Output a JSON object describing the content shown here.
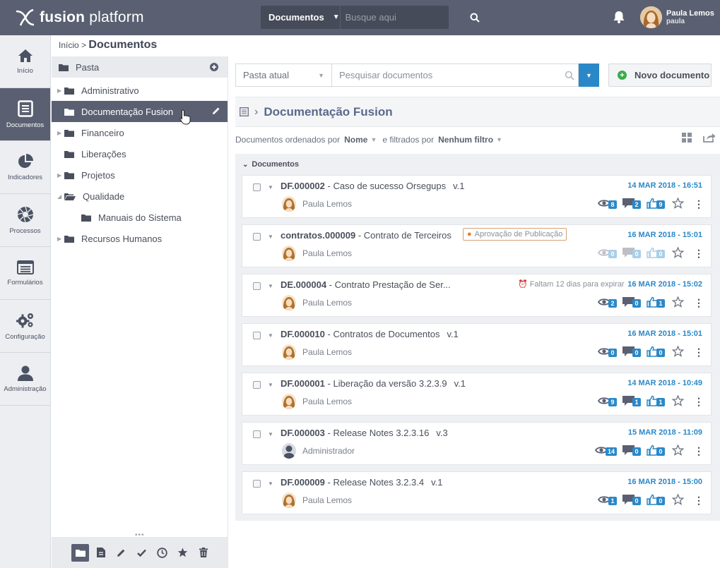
{
  "brand": {
    "name_bold": "fusion",
    "name_rest": " platform"
  },
  "search": {
    "scope": "Documentos",
    "placeholder": "Busque aqui"
  },
  "user": {
    "name": "Paula Lemos",
    "login": "paula"
  },
  "rail": [
    {
      "label": "Início",
      "icon": "home-icon",
      "active": false
    },
    {
      "label": "Documentos",
      "icon": "document-icon",
      "active": true
    },
    {
      "label": "Indicadores",
      "icon": "pie-chart-icon",
      "active": false
    },
    {
      "label": "Processos",
      "icon": "aperture-icon",
      "active": false
    },
    {
      "label": "Formulários",
      "icon": "form-icon",
      "active": false
    },
    {
      "label": "Configuração",
      "icon": "gears-icon",
      "active": false
    },
    {
      "label": "Administração",
      "icon": "user-icon",
      "active": false
    }
  ],
  "breadcrumb": {
    "home": "Início",
    "sep": ">",
    "current": "Documentos"
  },
  "folders": {
    "header": "Pasta",
    "items": [
      {
        "label": "Administrativo",
        "level": 0,
        "expandable": true,
        "open": false,
        "active": false
      },
      {
        "label": "Documentação Fusion",
        "level": 0,
        "expandable": false,
        "open": false,
        "active": true
      },
      {
        "label": "Financeiro",
        "level": 0,
        "expandable": true,
        "open": false,
        "active": false
      },
      {
        "label": "Liberações",
        "level": 0,
        "expandable": false,
        "open": false,
        "active": false
      },
      {
        "label": "Projetos",
        "level": 0,
        "expandable": true,
        "open": false,
        "active": false
      },
      {
        "label": "Qualidade",
        "level": 0,
        "expandable": true,
        "open": true,
        "active": false
      },
      {
        "label": "Manuais do Sistema",
        "level": 1,
        "expandable": false,
        "open": false,
        "active": false
      },
      {
        "label": "Recursos Humanos",
        "level": 0,
        "expandable": true,
        "open": false,
        "active": false
      }
    ],
    "footer_icons": [
      "folder-icon",
      "file-icon",
      "pencil-icon",
      "check-icon",
      "clock-icon",
      "star-icon",
      "trash-icon"
    ]
  },
  "toolbar": {
    "scope": "Pasta atual",
    "search_placeholder": "Pesquisar documentos",
    "new_doc": "Novo documento"
  },
  "folder_title": "Documentação Fusion",
  "sort": {
    "prefix": "Documentos ordenados por",
    "order": "Nome",
    "filter_prefix": "e filtrados por",
    "filter": "Nenhum filtro"
  },
  "list": {
    "group": "Documentos",
    "docs": [
      {
        "code": "DF.000002",
        "title": " - Caso de sucesso Orsegups",
        "version": "v.1",
        "date": "14 MAR 2018 - 16:51",
        "author": "Paula Lemos",
        "author_avatar": "woman",
        "views": "8",
        "comments": "2",
        "likes": "9",
        "faded": false,
        "badge": "",
        "expire": ""
      },
      {
        "code": "contratos.000009",
        "title": " - Contrato de Terceiros",
        "version": "",
        "date": "16 MAR 2018 - 15:01",
        "author": "Paula Lemos",
        "author_avatar": "woman",
        "views": "0",
        "comments": "0",
        "likes": "0",
        "faded": true,
        "badge": "Aprovação de Publicação",
        "expire": ""
      },
      {
        "code": "DE.000004",
        "title": " - Contrato Prestação de Ser...",
        "version": "",
        "date": "16 MAR 2018 - 15:02",
        "author": "Paula Lemos",
        "author_avatar": "woman",
        "views": "2",
        "comments": "0",
        "likes": "1",
        "faded": false,
        "badge": "",
        "expire": "Faltam 12 dias para expirar"
      },
      {
        "code": "DF.000010",
        "title": " - Contratos de Documentos",
        "version": "v.1",
        "date": "16 MAR 2018 - 15:01",
        "author": "Paula Lemos",
        "author_avatar": "woman",
        "views": "0",
        "comments": "0",
        "likes": "0",
        "faded": false,
        "badge": "",
        "expire": ""
      },
      {
        "code": "DF.000001",
        "title": " - Liberação da versão 3.2.3.9",
        "version": "v.1",
        "date": "14 MAR 2018 - 10:49",
        "author": "Paula Lemos",
        "author_avatar": "woman",
        "views": "9",
        "comments": "1",
        "likes": "1",
        "faded": false,
        "badge": "",
        "expire": ""
      },
      {
        "code": "DF.000003",
        "title": " - Release Notes 3.2.3.16",
        "version": "v.3",
        "date": "15 MAR 2018 - 11:09",
        "author": "Administrador",
        "author_avatar": "man",
        "views": "14",
        "comments": "0",
        "likes": "0",
        "faded": false,
        "badge": "",
        "expire": ""
      },
      {
        "code": "DF.000009",
        "title": " - Release Notes 3.2.3.4",
        "version": "v.1",
        "date": "16 MAR 2018 - 15:00",
        "author": "Paula Lemos",
        "author_avatar": "woman",
        "views": "1",
        "comments": "0",
        "likes": "0",
        "faded": false,
        "badge": "",
        "expire": ""
      }
    ]
  },
  "colors": {
    "topbar": "#5a6071",
    "accent": "#2b88c8",
    "green": "#3bab48",
    "badge_dot": "#e67e22"
  }
}
